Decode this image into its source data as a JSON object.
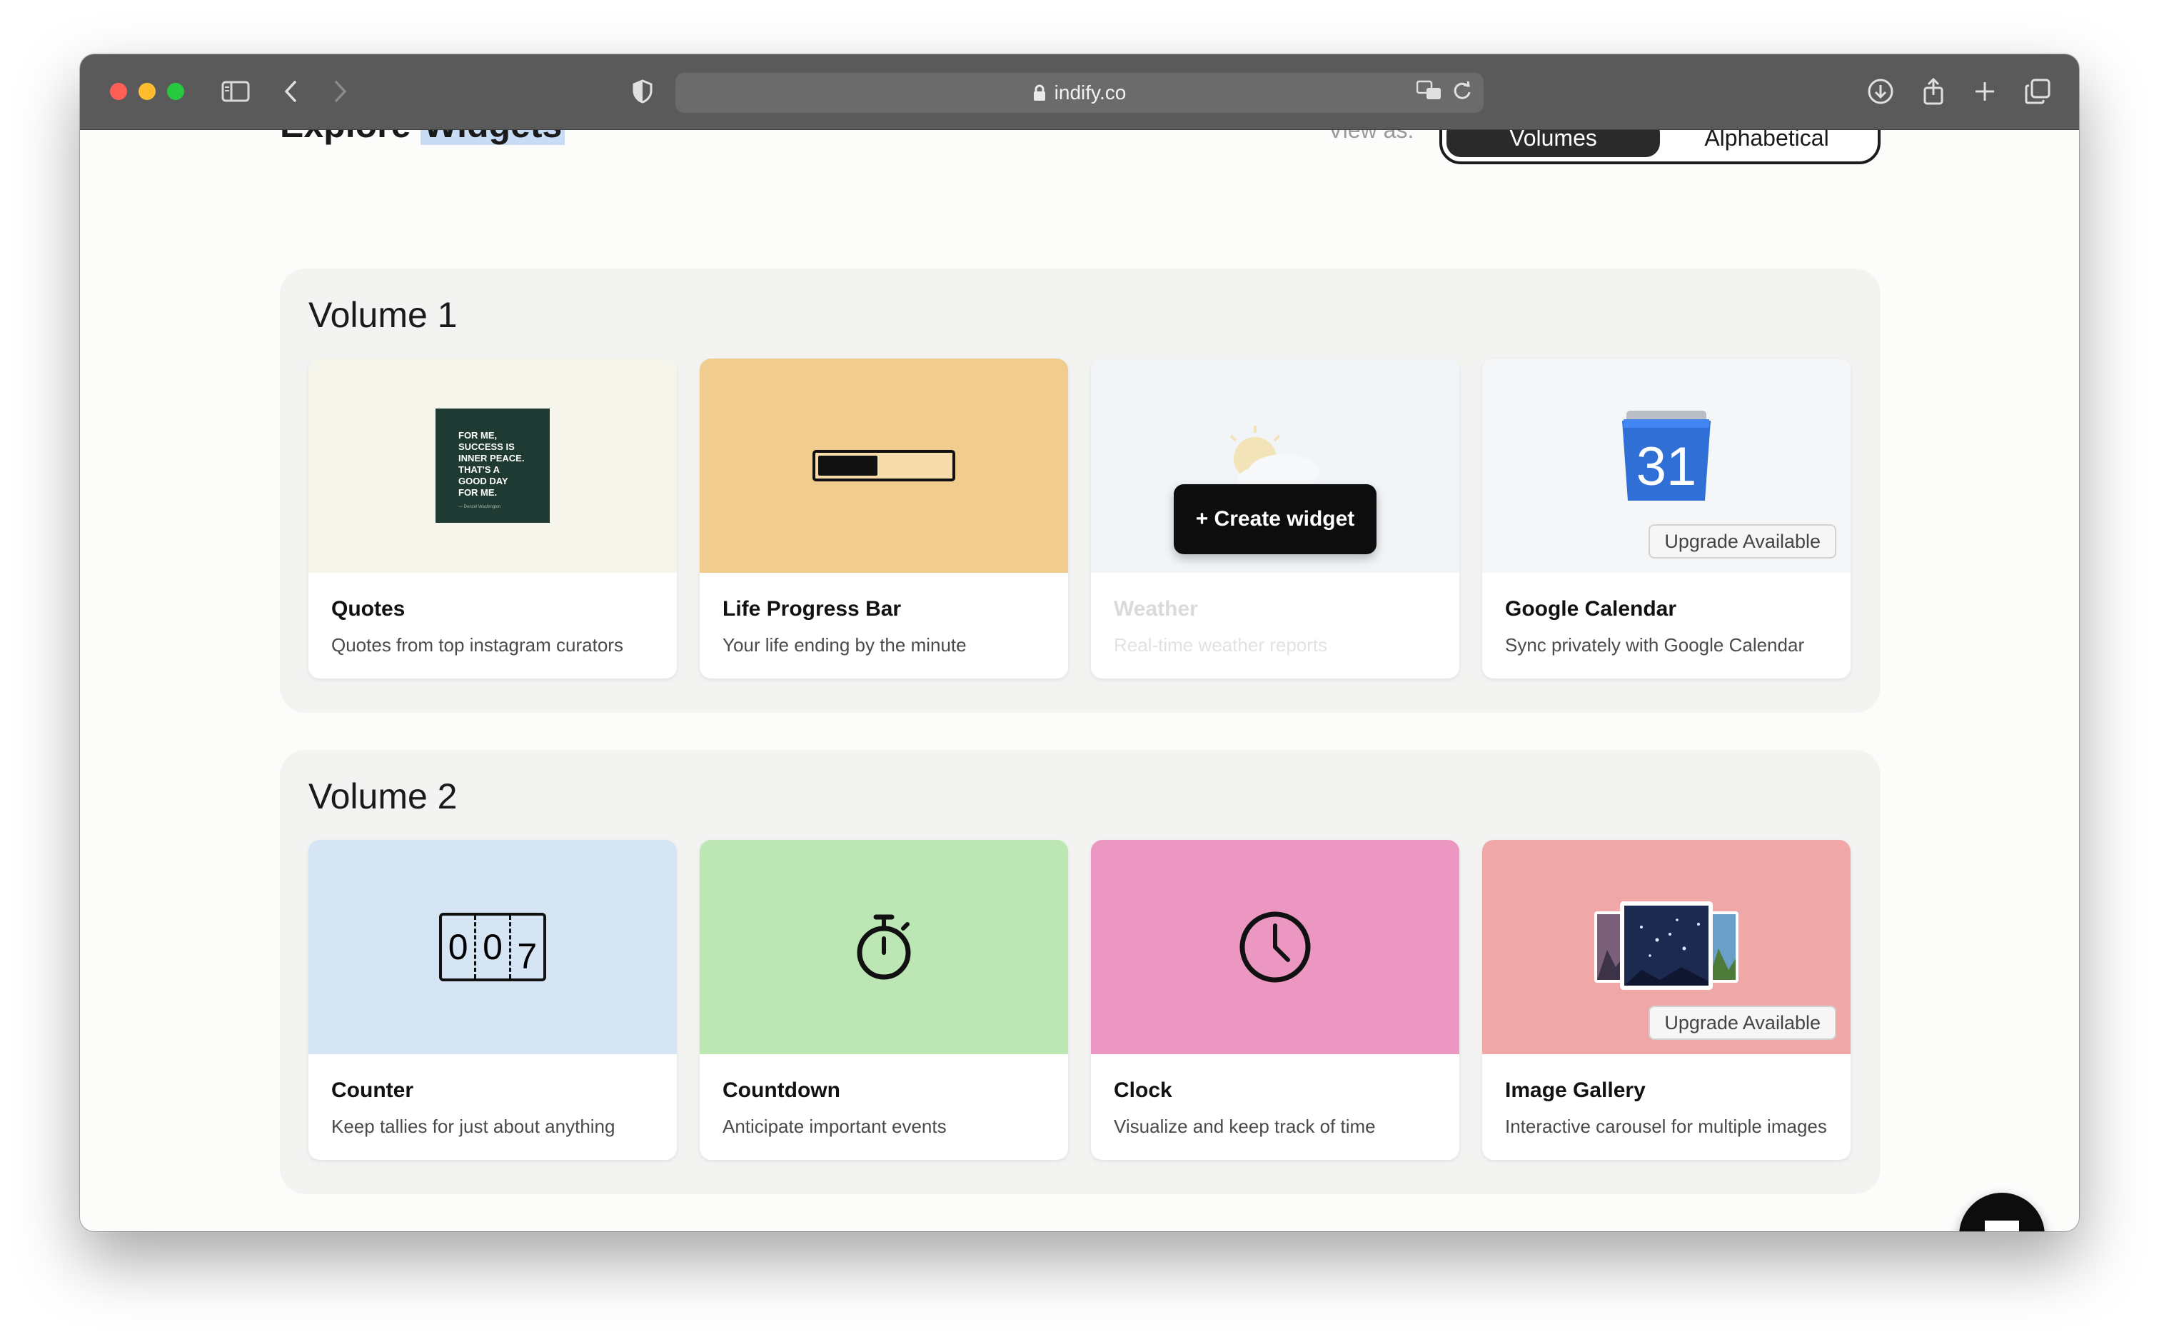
{
  "browser": {
    "url": "indify.co"
  },
  "page": {
    "title_part1": "Explore",
    "title_part2": "Widgets",
    "view_as_label": "View as:",
    "view_options": [
      "Volumes",
      "Alphabetical"
    ],
    "selected_view": "Volumes"
  },
  "volumes": [
    {
      "title": "Volume 1",
      "cards": [
        {
          "name": "Quotes",
          "description": "Quotes from top instagram curators",
          "color": "#f6f5ec",
          "quote_lines": [
            "FOR ME,",
            "SUCCESS IS",
            "INNER PEACE.",
            "THAT'S A",
            "GOOD DAY",
            "FOR ME."
          ],
          "quote_author": "— Denzel Washington"
        },
        {
          "name": "Life Progress Bar",
          "description": "Your life ending by the minute",
          "color": "#f0cd8f",
          "progress": 0.45
        },
        {
          "name": "Weather",
          "description": "Real-time weather reports",
          "color": "#f2f5f8",
          "action_label": "+ Create widget"
        },
        {
          "name": "Google Calendar",
          "description": "Sync privately with Google Calendar",
          "color": "#f5f6f7",
          "badge": "Upgrade Available",
          "calendar_day": "31"
        }
      ]
    },
    {
      "title": "Volume 2",
      "cards": [
        {
          "name": "Counter",
          "description": "Keep tallies for just about anything",
          "color": "#d6e5f3",
          "digits": [
            "0",
            "0",
            "7"
          ]
        },
        {
          "name": "Countdown",
          "description": "Anticipate important events",
          "color": "#bce6b4"
        },
        {
          "name": "Clock",
          "description": "Visualize and keep track of time",
          "color": "#ec96c2"
        },
        {
          "name": "Image Gallery",
          "description": "Interactive carousel for multiple images",
          "color": "#f0a7a7",
          "badge": "Upgrade Available"
        }
      ]
    }
  ]
}
